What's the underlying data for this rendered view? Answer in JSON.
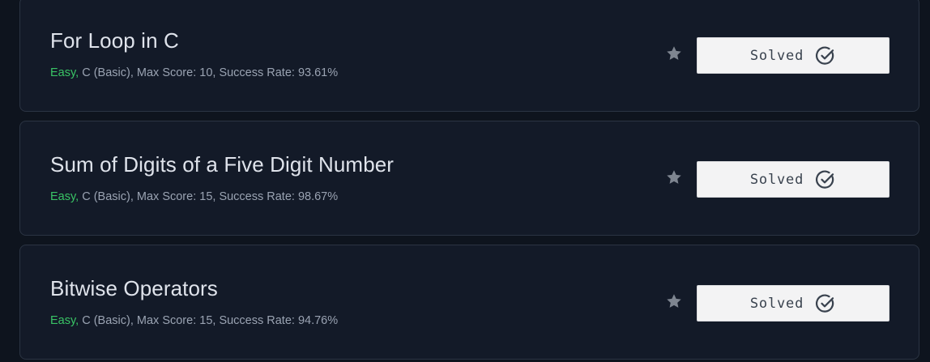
{
  "challenges": [
    {
      "title": "For Loop in C",
      "difficulty": "Easy,",
      "details": " C (Basic), Max Score: 10, Success Rate: 93.61%",
      "button_label": "Solved"
    },
    {
      "title": "Sum of Digits of a Five Digit Number",
      "difficulty": "Easy,",
      "details": " C (Basic), Max Score: 15, Success Rate: 98.67%",
      "button_label": "Solved"
    },
    {
      "title": "Bitwise Operators",
      "difficulty": "Easy,",
      "details": " C (Basic), Max Score: 15, Success Rate: 94.76%",
      "button_label": "Solved"
    }
  ],
  "icons": {
    "bookmark": "star-icon",
    "solved": "check-circle-icon"
  },
  "colors": {
    "background": "#0e141e",
    "card": "#131a28",
    "difficulty_easy": "#39c365",
    "button": "#f3f3f4"
  }
}
